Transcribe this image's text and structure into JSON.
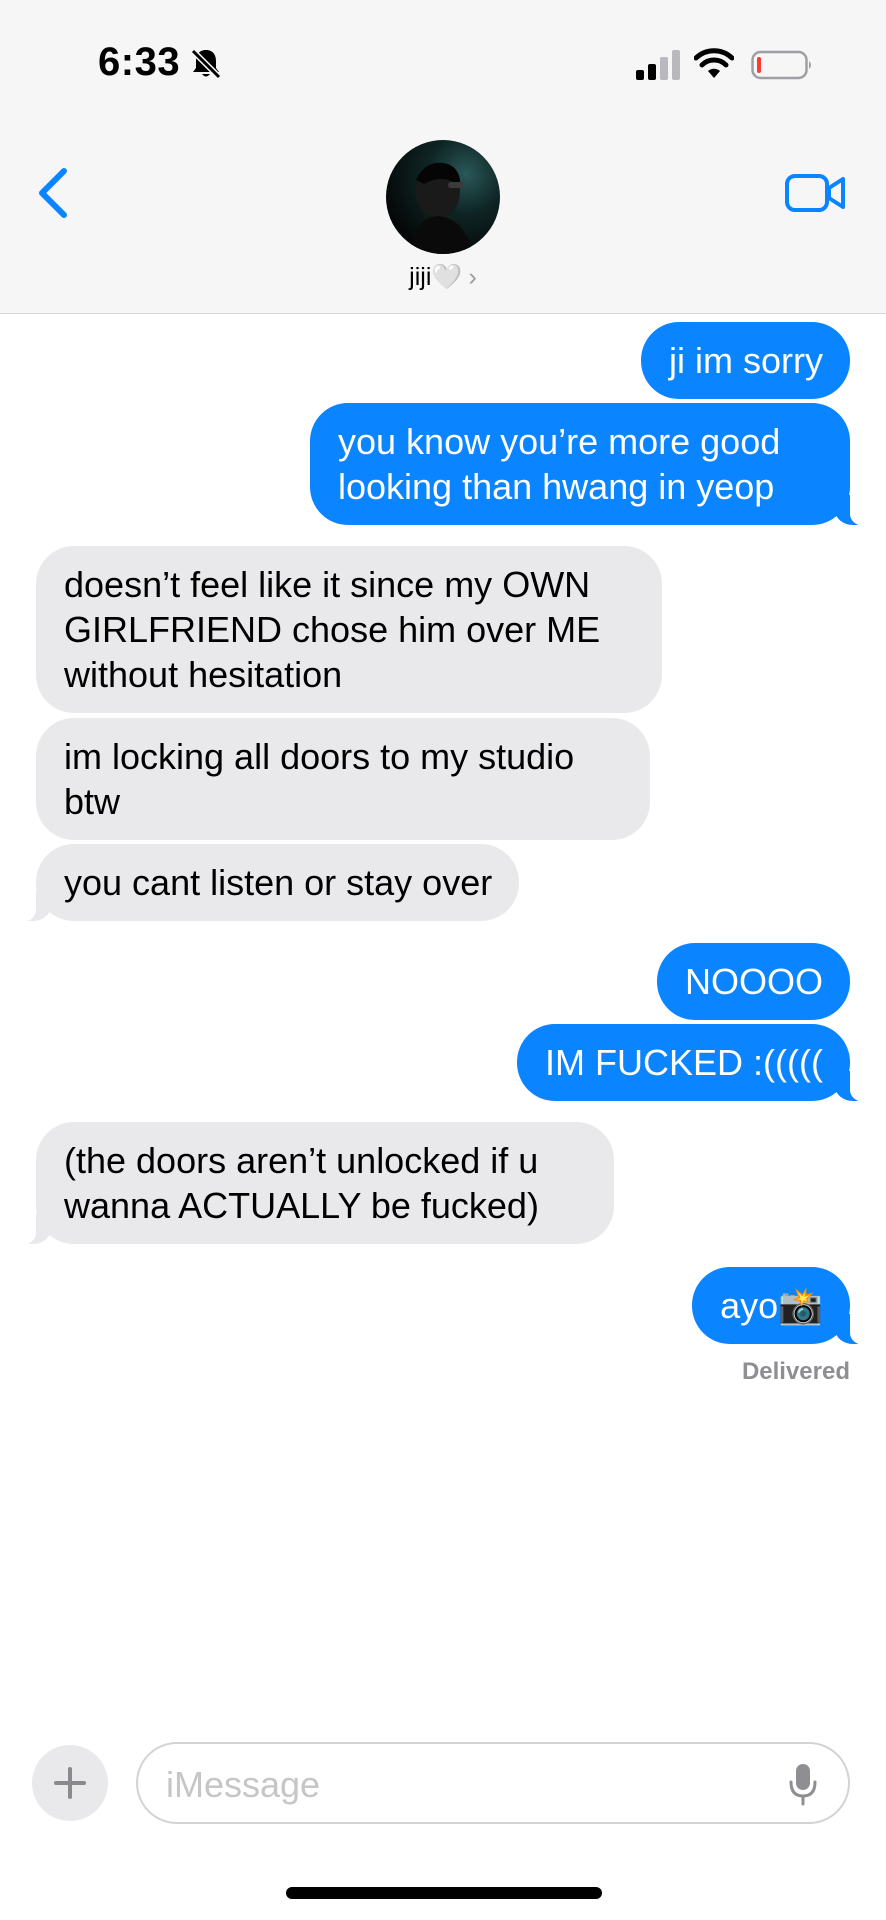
{
  "status_bar": {
    "time": "6:33"
  },
  "header": {
    "contact_name": "jiji🤍",
    "chevron": "›"
  },
  "messages": [
    {
      "side": "out",
      "text": "ji im sorry"
    },
    {
      "side": "out",
      "text": "you know you’re more good looking than hwang in yeop"
    },
    {
      "side": "in",
      "text": "doesn’t feel like it since my OWN GIRLFRIEND chose him over ME without hesitation"
    },
    {
      "side": "in",
      "text": "im locking all doors to my studio btw"
    },
    {
      "side": "in",
      "text": "you cant listen or stay over"
    },
    {
      "side": "out",
      "text": "NOOOO"
    },
    {
      "side": "out",
      "text": "IM FUCKED :((((("
    },
    {
      "side": "in",
      "text": "(the doors aren’t unlocked if u wanna ACTUALLY be fucked)"
    },
    {
      "side": "out",
      "text": "ayo📸"
    }
  ],
  "delivered": "Delivered",
  "composer": {
    "placeholder": "iMessage"
  },
  "colors": {
    "outgoing": "#0a84ff",
    "incoming": "#e9e9eb",
    "accent": "#0a84ff"
  },
  "icons": [
    "bell-slash-icon",
    "cellular-signal-icon",
    "wifi-icon",
    "battery-low-icon",
    "back-chevron-icon",
    "video-camera-icon",
    "plus-icon",
    "microphone-icon"
  ]
}
